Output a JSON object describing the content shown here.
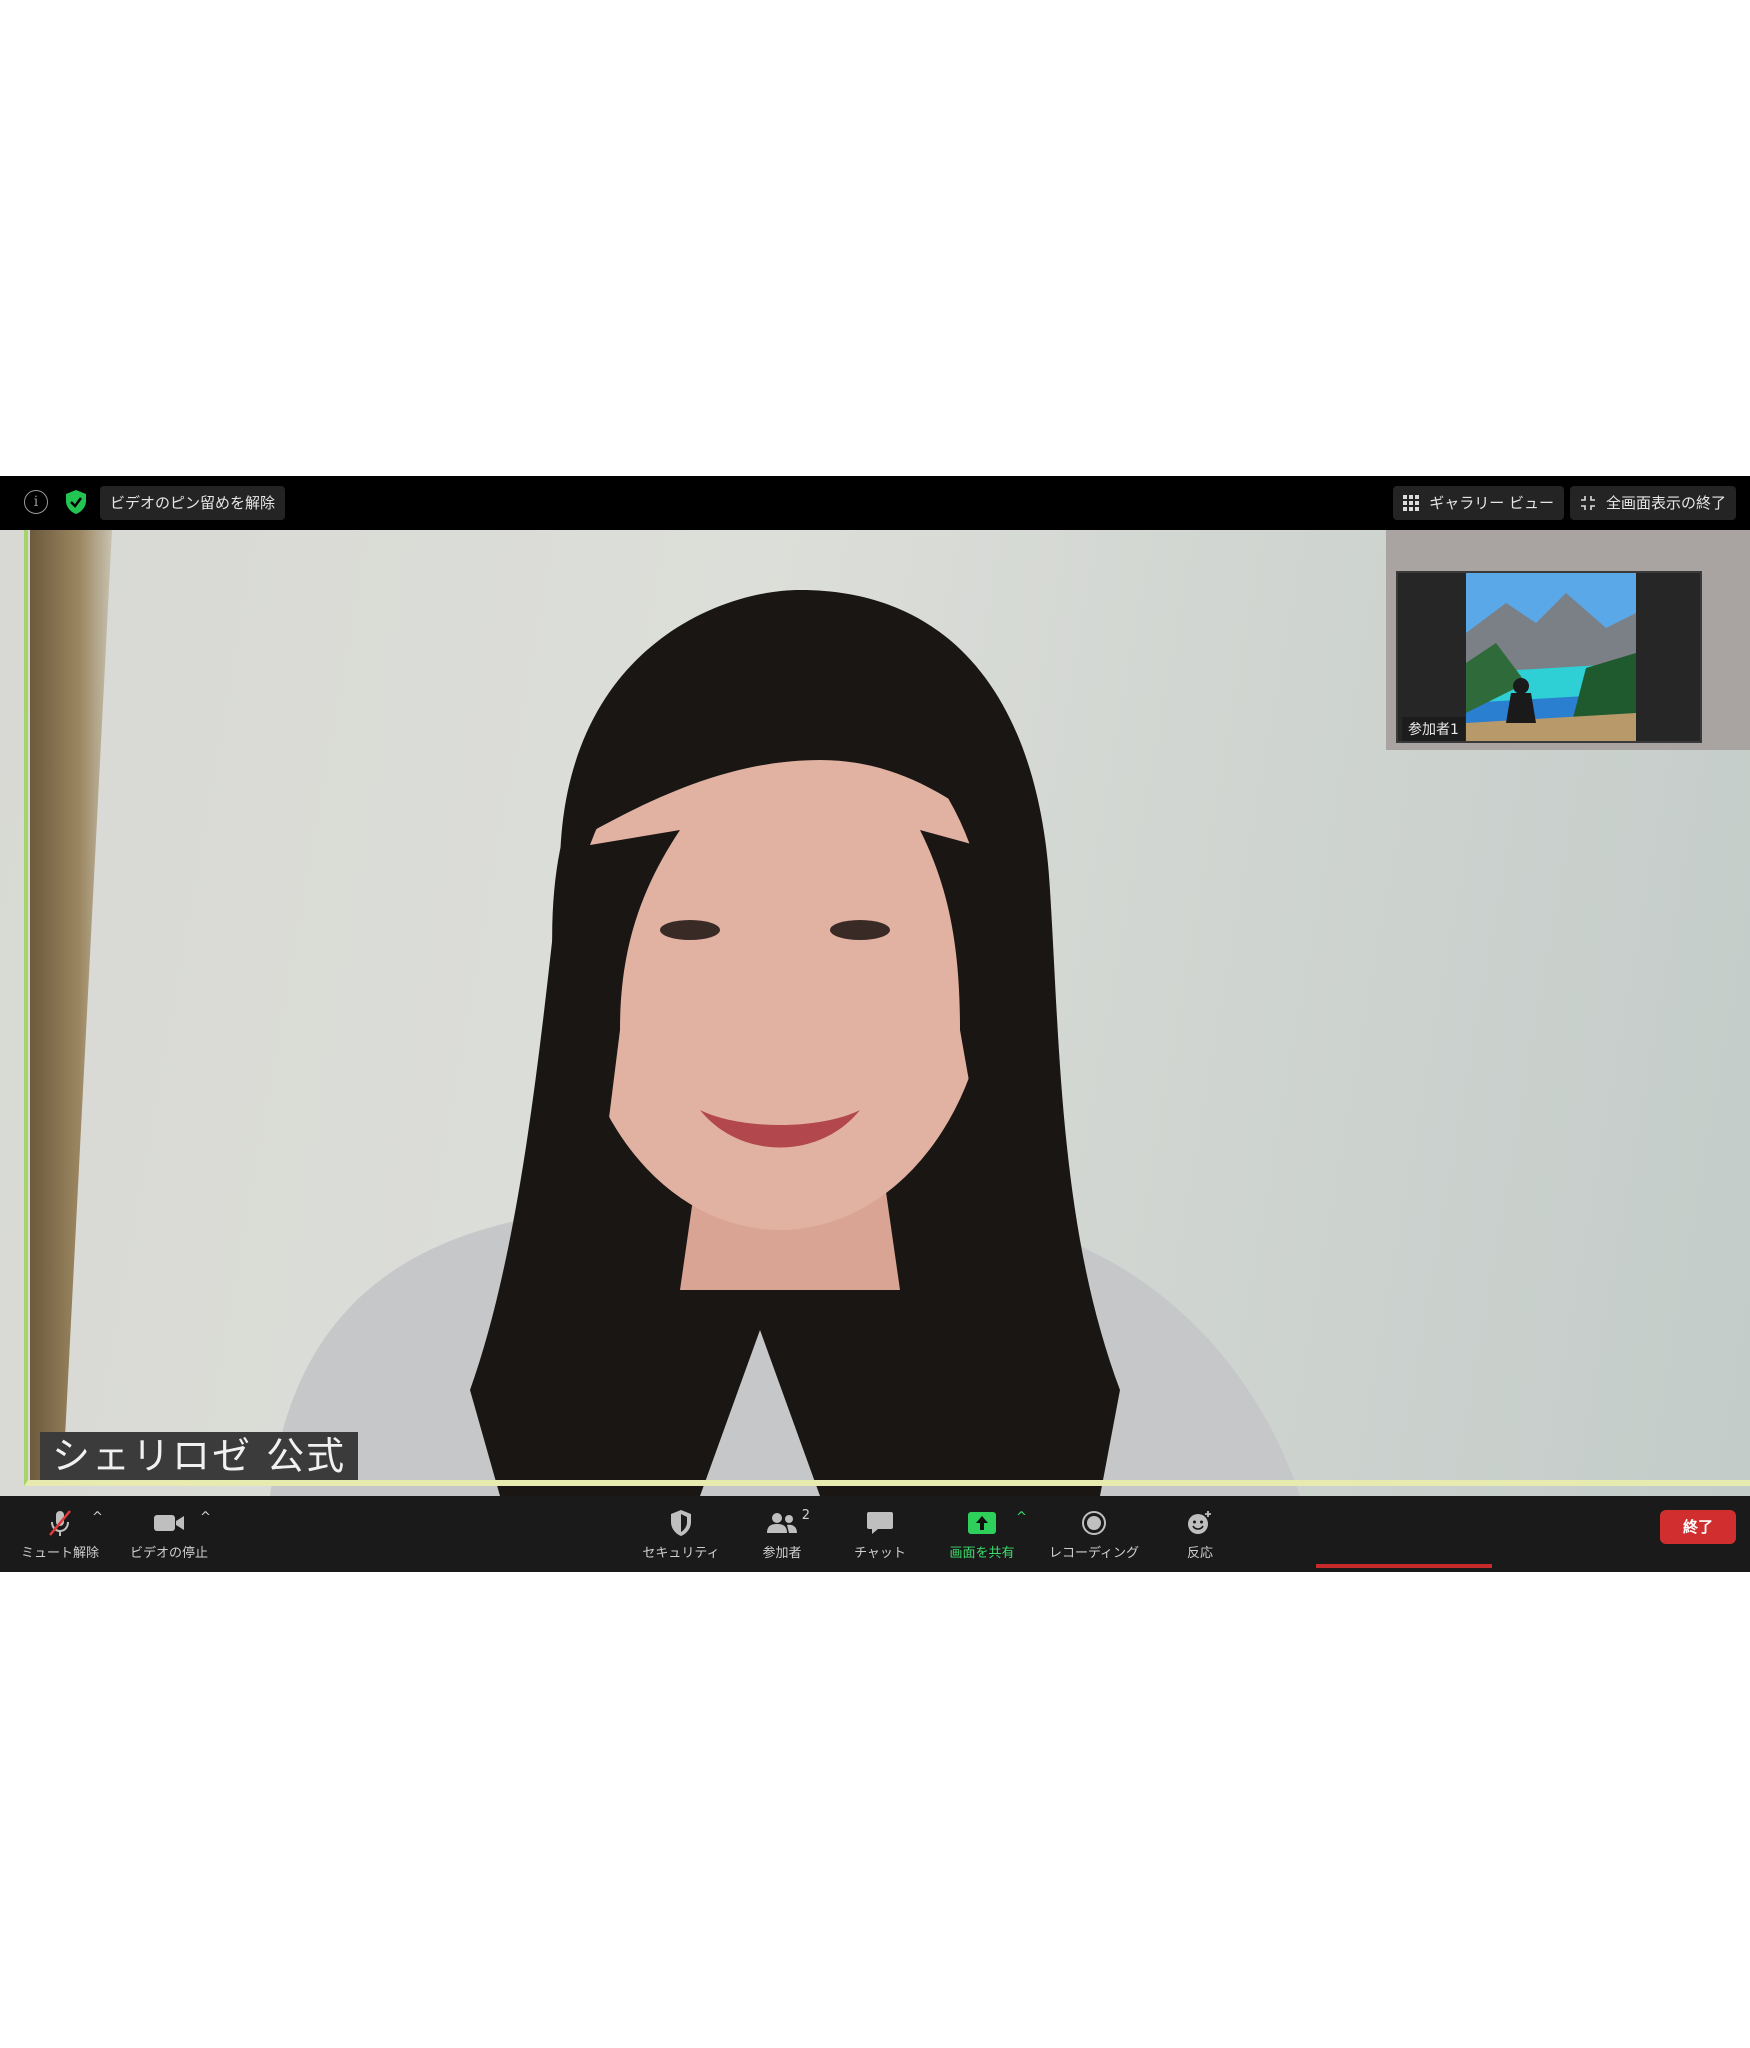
{
  "top_bar": {
    "info_icon": "info-icon",
    "security_icon": "shield-check-icon",
    "unpin_label": "ビデオのピン留めを解除",
    "gallery_view_label": "ギャラリー ビュー",
    "exit_fullscreen_label": "全画面表示の終了"
  },
  "main_video": {
    "speaker_name": "シェリロゼ 公式"
  },
  "thumbnail": {
    "label": "参加者1"
  },
  "toolbar": {
    "mute_label": "ミュート解除",
    "video_label": "ビデオの停止",
    "security_label": "セキュリティ",
    "participants_label": "参加者",
    "participants_count": "2",
    "chat_label": "チャット",
    "share_label": "画面を共有",
    "record_label": "レコーディング",
    "reactions_label": "反応",
    "end_label": "終了",
    "caret": "^"
  },
  "colors": {
    "share_accent": "#3ddc6c",
    "end_button": "#d12f2f",
    "active_speaker_border": "#e7ebb0"
  }
}
